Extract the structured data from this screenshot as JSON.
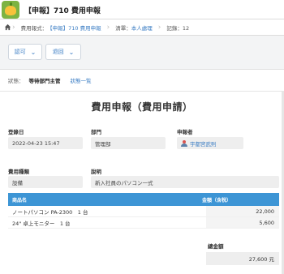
{
  "window": {
    "title": "【申報】710 費用申報"
  },
  "breadcrumb": {
    "items": [
      {
        "label": "費用報式：",
        "link": "【申報】710 費用申報"
      },
      {
        "label": "清單：",
        "link": "本人處理"
      },
      {
        "label": "記錄：12",
        "link": ""
      }
    ]
  },
  "toolbar": {
    "approve_label": "認可",
    "return_label": "退回"
  },
  "status": {
    "label": "狀態：",
    "value": "等待部門主管",
    "link": "狀態一覧"
  },
  "form": {
    "title": "費用申報（費用申請）",
    "fields": {
      "date": {
        "label": "登錄日",
        "value": "2022-04-23 15:47"
      },
      "dept": {
        "label": "部門",
        "value": "管理部"
      },
      "applicant": {
        "label": "申報者",
        "value": "宇都宮武則"
      },
      "category": {
        "label": "費用種類",
        "value": "設備"
      },
      "description": {
        "label": "說明",
        "value": "新入社員のパソコン一式"
      }
    },
    "table": {
      "headers": [
        "商品名",
        "金額（含稅）"
      ],
      "rows": [
        {
          "name": "ノートパソコン PA-2300　1 台",
          "amount": "22,000"
        },
        {
          "name": "24\"  卓上モニター　1 台",
          "amount": "5,600"
        }
      ]
    },
    "total": {
      "label": "總金額",
      "value": "27,600 元"
    }
  },
  "colors": {
    "accent": "#3d95d5",
    "link": "#3b7dc4",
    "app_icon_bg": "#7cb342"
  },
  "icons": {
    "app": "leaf-app-icon",
    "home": "home-icon",
    "user": "user-icon"
  }
}
